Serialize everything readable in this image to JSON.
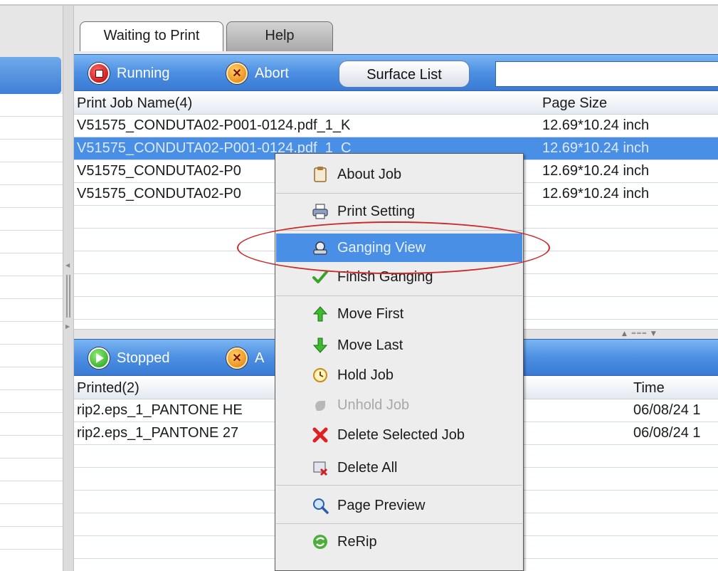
{
  "tabs": [
    {
      "label": "Waiting to Print",
      "active": true
    },
    {
      "label": "Help",
      "active": false
    }
  ],
  "top_toolbar": {
    "running_label": "Running",
    "abort_label": "Abort",
    "surface_list_label": "Surface List"
  },
  "print_jobs": {
    "headers": [
      "Print Job Name(4)",
      "Page Size"
    ],
    "rows": [
      {
        "name": "V51575_CONDUTA02-P001-0124.pdf_1_K",
        "size": "12.69*10.24 inch",
        "selected": false
      },
      {
        "name": "V51575_CONDUTA02-P001-0124.pdf_1_C",
        "size": "12.69*10.24 inch",
        "selected": true
      },
      {
        "name": "V51575_CONDUTA02-P0",
        "size": "12.69*10.24 inch",
        "selected": false
      },
      {
        "name": "V51575_CONDUTA02-P0",
        "size": "12.69*10.24 inch",
        "selected": false
      }
    ]
  },
  "bottom_toolbar": {
    "stopped_label": "Stopped",
    "abort_label": "A"
  },
  "printed_jobs": {
    "headers": [
      "Printed(2)",
      "Time"
    ],
    "rows": [
      {
        "name": "rip2.eps_1_PANTONE HE",
        "time": "06/08/24 1"
      },
      {
        "name": "rip2.eps_1_PANTONE 27",
        "time": "06/08/24 1"
      }
    ]
  },
  "context_menu": {
    "items": [
      {
        "label": "About Job",
        "icon": "clipboard-icon"
      },
      {
        "label": "Print Setting",
        "icon": "printer-icon"
      },
      {
        "label": "Ganging View",
        "icon": "ganging-icon",
        "highlighted": true
      },
      {
        "label": "Finish Ganging",
        "icon": "checkmark-icon"
      },
      {
        "label": "Move First",
        "icon": "arrow-up-icon"
      },
      {
        "label": "Move Last",
        "icon": "arrow-down-icon"
      },
      {
        "label": "Hold Job",
        "icon": "clock-icon"
      },
      {
        "label": "Unhold Job",
        "icon": "hand-icon",
        "disabled": true
      },
      {
        "label": "Delete Selected Job",
        "icon": "red-x-icon"
      },
      {
        "label": "Delete All",
        "icon": "delete-all-icon"
      },
      {
        "label": "Page Preview",
        "icon": "magnifier-icon"
      },
      {
        "label": "ReRip",
        "icon": "refresh-icon"
      }
    ]
  },
  "colors": {
    "toolbar_blue": "#4c8fe2",
    "selection_blue": "#4a8fe6",
    "annotation_red": "#cc2a2a"
  }
}
